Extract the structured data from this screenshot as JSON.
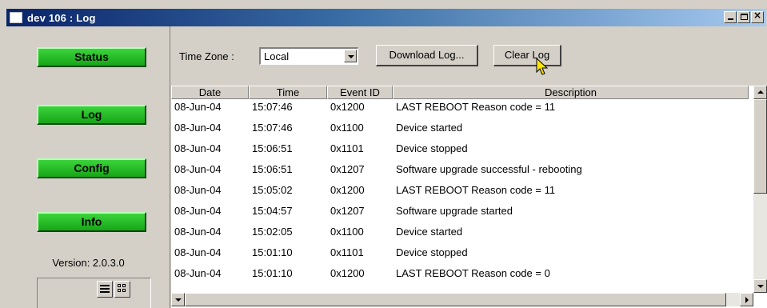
{
  "window": {
    "title": "dev 106 : Log",
    "controls": {
      "minimize_icon": "minimize-icon",
      "maximize_icon": "maximize-icon",
      "close_glyph": "×"
    }
  },
  "sidebar": {
    "buttons": [
      {
        "label": "Status"
      },
      {
        "label": "Log"
      },
      {
        "label": "Config"
      },
      {
        "label": "Info"
      }
    ],
    "version": "Version: 2.0.3.0",
    "button_color": "#22b822"
  },
  "toolbar": {
    "timezone_label": "Time Zone :",
    "timezone_value": "Local",
    "download_label": "Download Log...",
    "clear_label": "Clear Log"
  },
  "table": {
    "columns": [
      "Date",
      "Time",
      "Event ID",
      "Description"
    ],
    "rows": [
      [
        "08-Jun-04",
        "15:07:46",
        "0x1200",
        "LAST REBOOT Reason code = 11"
      ],
      [
        "08-Jun-04",
        "15:07:46",
        "0x1100",
        "Device started"
      ],
      [
        "08-Jun-04",
        "15:06:51",
        "0x1101",
        "Device stopped"
      ],
      [
        "08-Jun-04",
        "15:06:51",
        "0x1207",
        "Software upgrade successful - rebooting"
      ],
      [
        "08-Jun-04",
        "15:05:02",
        "0x1200",
        "LAST REBOOT Reason code = 11"
      ],
      [
        "08-Jun-04",
        "15:04:57",
        "0x1207",
        "Software upgrade started"
      ],
      [
        "08-Jun-04",
        "15:02:05",
        "0x1100",
        "Device started"
      ],
      [
        "08-Jun-04",
        "15:01:10",
        "0x1101",
        "Device stopped"
      ],
      [
        "08-Jun-04",
        "15:01:10",
        "0x1200",
        "LAST REBOOT Reason code = 0"
      ]
    ]
  }
}
